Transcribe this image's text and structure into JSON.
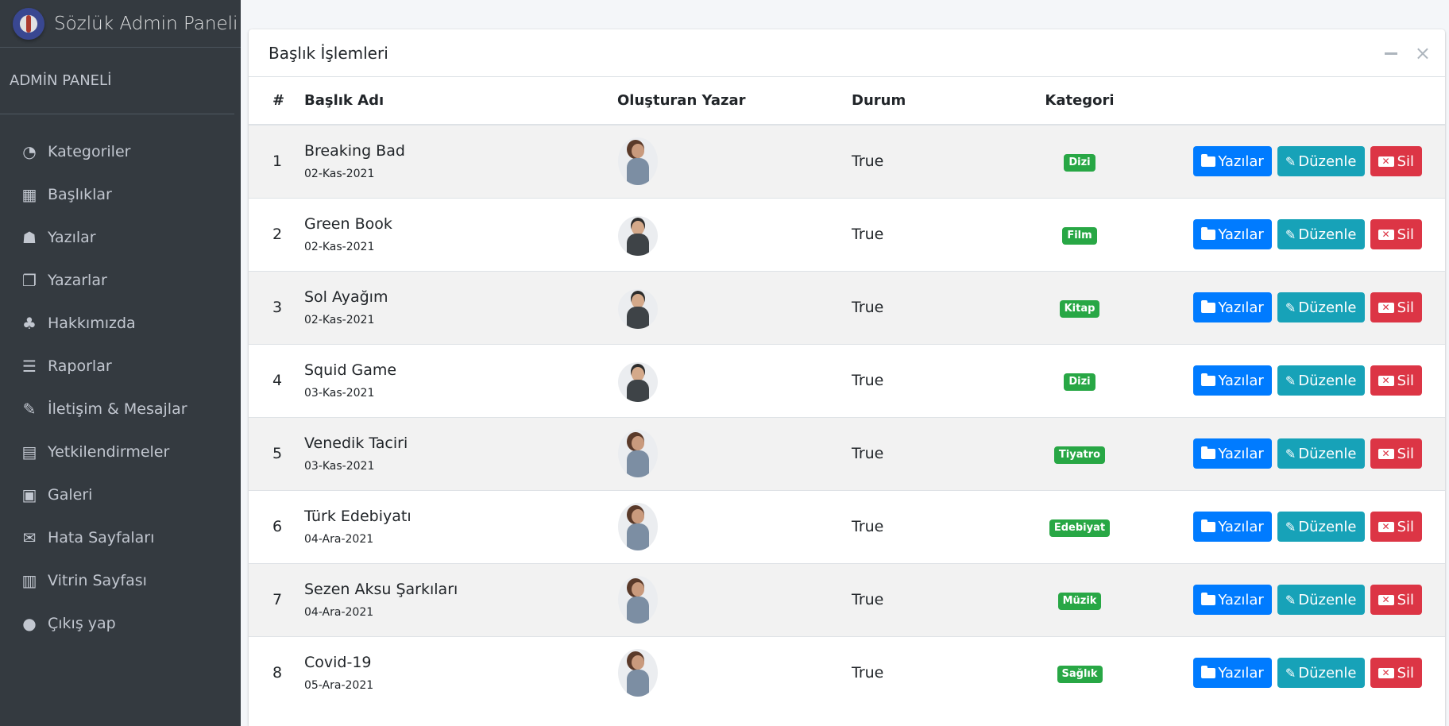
{
  "sidebar": {
    "brand_title": "Sözlük Admin Paneli",
    "panel_label": "ADMİN PANELİ",
    "items": [
      {
        "label": "Kategoriler",
        "icon": "dashboard-icon"
      },
      {
        "label": "Başlıklar",
        "icon": "grid-icon"
      },
      {
        "label": "Yazılar",
        "icon": "reader-icon"
      },
      {
        "label": "Yazarlar",
        "icon": "copy-icon"
      },
      {
        "label": "Hakkımızda",
        "icon": "tree-icon"
      },
      {
        "label": "Raporlar",
        "icon": "list-icon"
      },
      {
        "label": "İletişim & Mesajlar",
        "icon": "edit-icon"
      },
      {
        "label": "Yetkilendirmeler",
        "icon": "calendar-icon"
      },
      {
        "label": "Galeri",
        "icon": "image-icon"
      },
      {
        "label": "Hata Sayfaları",
        "icon": "envelope-icon"
      },
      {
        "label": "Vitrin Sayfası",
        "icon": "book-icon"
      },
      {
        "label": "Çıkış yap",
        "icon": "apple-icon"
      }
    ]
  },
  "card": {
    "title": "Başlık İşlemleri"
  },
  "table": {
    "headers": {
      "num": "#",
      "title": "Başlık Adı",
      "author": "Oluşturan Yazar",
      "status": "Durum",
      "category": "Kategori"
    },
    "buttons": {
      "posts": "Yazılar",
      "edit": "Düzenle",
      "delete": "Sil"
    },
    "rows": [
      {
        "num": "1",
        "title": "Breaking Bad",
        "date": "02-Kas-2021",
        "author_avatar": "female",
        "status": "True",
        "category": "Dizi"
      },
      {
        "num": "2",
        "title": "Green Book",
        "date": "02-Kas-2021",
        "author_avatar": "male",
        "status": "True",
        "category": "Film"
      },
      {
        "num": "3",
        "title": "Sol Ayağım",
        "date": "02-Kas-2021",
        "author_avatar": "male",
        "status": "True",
        "category": "Kitap"
      },
      {
        "num": "4",
        "title": "Squid Game",
        "date": "03-Kas-2021",
        "author_avatar": "male",
        "status": "True",
        "category": "Dizi"
      },
      {
        "num": "5",
        "title": "Venedik Taciri",
        "date": "03-Kas-2021",
        "author_avatar": "female",
        "status": "True",
        "category": "Tiyatro"
      },
      {
        "num": "6",
        "title": "Türk Edebiyatı",
        "date": "04-Ara-2021",
        "author_avatar": "female",
        "status": "True",
        "category": "Edebiyat"
      },
      {
        "num": "7",
        "title": "Sezen Aksu Şarkıları",
        "date": "04-Ara-2021",
        "author_avatar": "female",
        "status": "True",
        "category": "Müzik"
      },
      {
        "num": "8",
        "title": "Covid-19",
        "date": "05-Ara-2021",
        "author_avatar": "female",
        "status": "True",
        "category": "Sağlık"
      }
    ]
  },
  "colors": {
    "sidebar_bg": "#343a40",
    "primary": "#007bff",
    "info": "#17a2b8",
    "danger": "#dc3545",
    "success": "#28a745"
  }
}
